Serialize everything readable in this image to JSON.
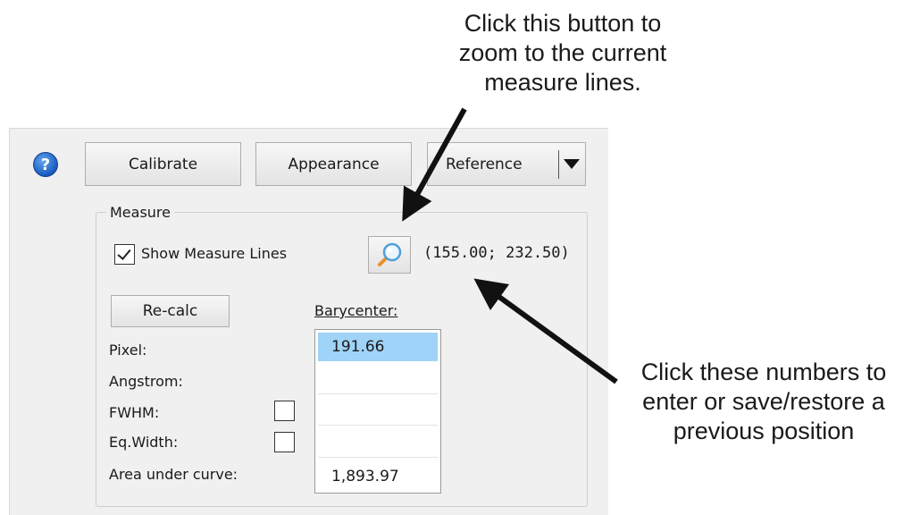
{
  "toolbar": {
    "calibrate_label": "Calibrate",
    "appearance_label": "Appearance",
    "reference_label": "Reference"
  },
  "measure": {
    "group_title": "Measure",
    "show_lines_label": "Show Measure Lines",
    "show_lines_checked": true,
    "coords": "(155.00; 232.50)",
    "recalc_label": "Re-calc",
    "barycenter_header": "Barycenter:",
    "rows": {
      "pixel_label": "Pixel:",
      "angstrom_label": "Angstrom:",
      "fwhm_label": "FWHM:",
      "eqw_label": "Eq.Width:",
      "area_label": "Area under curve:"
    },
    "values": {
      "pixel": "191.66",
      "angstrom": "",
      "fwhm": "",
      "eqw": "",
      "area": "1,893.97"
    }
  },
  "annotations": {
    "zoom_lines": [
      "Click this button to",
      "zoom to the current",
      "measure lines."
    ],
    "coords_lines": [
      "Click these numbers to",
      "enter or save/restore a",
      "previous position"
    ]
  },
  "icons": {
    "help": "help-icon",
    "zoom": "magnifier-icon",
    "dropdown": "chevron-down-icon"
  },
  "colors": {
    "panel_bg": "#f0f0f0",
    "help_blue": "#1d6fd1",
    "selection": "#9fd3f7"
  }
}
